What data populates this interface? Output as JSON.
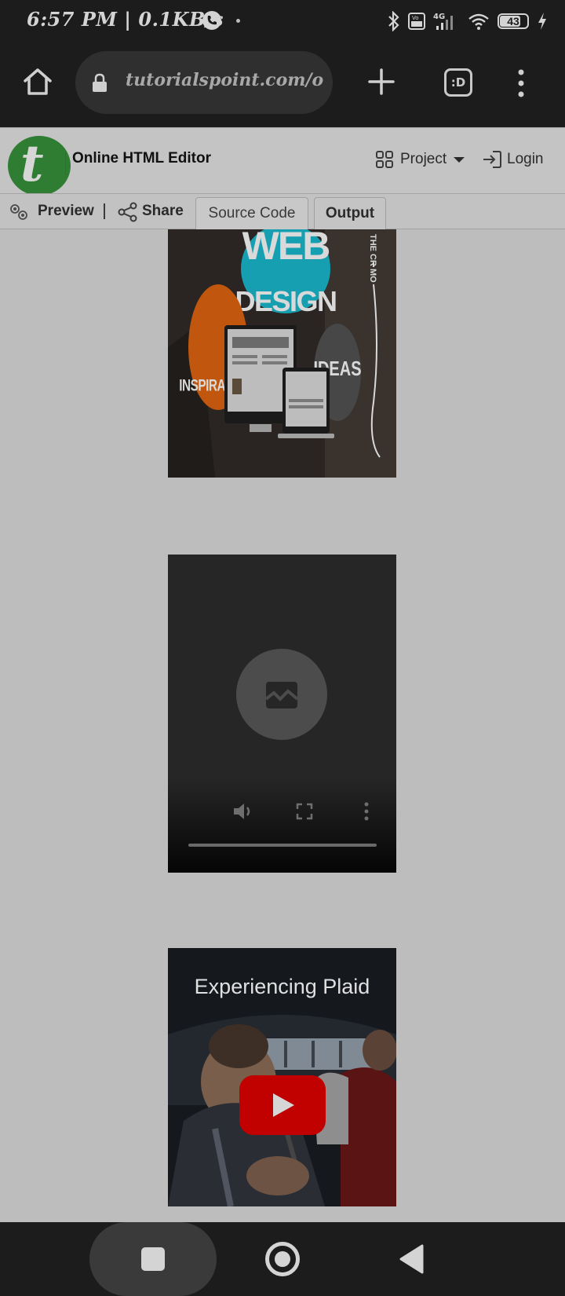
{
  "status_bar": {
    "time": "6:57 PM | 0.1KB/s",
    "battery": "43"
  },
  "browser": {
    "url": "tutorialspoint.com/online_html_editor.php",
    "tabs_label": ":D"
  },
  "site_header": {
    "logo_letter": "t",
    "title": "Online HTML Editor",
    "project_label": "Project",
    "login_label": "Login"
  },
  "toolbar": {
    "preview_label": "Preview",
    "separator": "|",
    "share_label": "Share",
    "tabs": [
      {
        "label": "Source Code",
        "active": false
      },
      {
        "label": "Output",
        "active": true
      }
    ]
  },
  "output": {
    "web_design_image": {
      "words": [
        "WEB",
        "DESIGN",
        "INSPIRATION",
        "IDEAS",
        "THE CR MO"
      ]
    },
    "video": {
      "state": "broken-media",
      "controls": [
        "volume-icon",
        "fullscreen-icon",
        "more-options-icon"
      ]
    },
    "youtube": {
      "title": "Experiencing Plaid"
    }
  },
  "colors": {
    "page_bg": "#bdbdbd",
    "chrome_bg": "#1c1c1c",
    "logo_green": "#2e7d32",
    "youtube_red": "#c10000"
  }
}
